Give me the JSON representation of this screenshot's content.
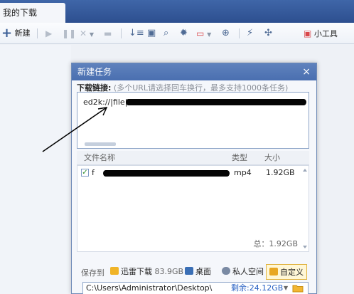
{
  "window": {
    "tab_title": "我的下载"
  },
  "toolbar": {
    "new_label": "新建",
    "tools_label": "小工具",
    "icons": [
      "plus-icon",
      "play-icon",
      "pause-icon",
      "delete-icon",
      "folder-icon",
      "sort-icon",
      "info-icon",
      "search-icon",
      "settings-icon",
      "vip-icon",
      "network-icon",
      "speed-icon",
      "game-icon",
      "toolbox-icon"
    ]
  },
  "dialog": {
    "title": "新建任务",
    "close_glyph": "×",
    "link_label": "下载链接:",
    "link_hint": "(多个URL请选择回车换行，最多支持1000条任务)",
    "link_value": "ed2k://|file|%E",
    "file_table": {
      "headers": [
        "文件名称",
        "类型",
        "大小"
      ],
      "rows": [
        {
          "checked": true,
          "name": "f",
          "type": "mp4",
          "size": "1.92GB"
        }
      ],
      "total": "总：1.92GB"
    },
    "save_to": {
      "label": "保存到",
      "options": [
        {
          "label": "迅雷下载",
          "free": "83.9GB",
          "icon": "download-folder-icon",
          "selected": false
        },
        {
          "label": "桌面",
          "icon": "desktop-icon",
          "selected": false
        },
        {
          "label": "私人空间",
          "icon": "private-space-icon",
          "selected": false
        },
        {
          "label": "自定义",
          "icon": "custom-folder-icon",
          "selected": true
        }
      ]
    },
    "path": {
      "value": "C:\\Users\\Administrator\\Desktop\\",
      "free": "剩余:24.12GB"
    }
  },
  "colors": {
    "title_bar": "#4a6fb0",
    "accent_blue": "#2a62c4",
    "selected_option_border": "#e0b340"
  }
}
